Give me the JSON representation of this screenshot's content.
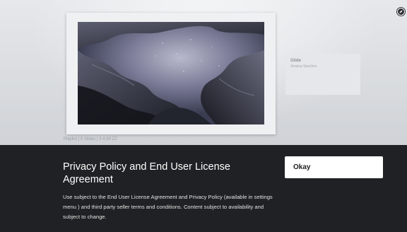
{
  "background": {
    "playlist_label": "Playlist | 5 Slides | 3.4.89 ZZ"
  },
  "artwork_info": {
    "title": "Glide",
    "artist": "Jessica Sanchez"
  },
  "icons": {
    "top_right": "compass-icon"
  },
  "dialog": {
    "title": "Privacy Policy and End User License Agreement",
    "body": "Use subject to the End User License Agreement and Privacy Policy (available in settings menu ) and third party seller terms and conditions. Content subject to availability and subject to change.",
    "okay_label": "Okay"
  },
  "colors": {
    "sheet_background": "#202124",
    "button_background": "#ffffff",
    "title_text": "#ffffff"
  }
}
